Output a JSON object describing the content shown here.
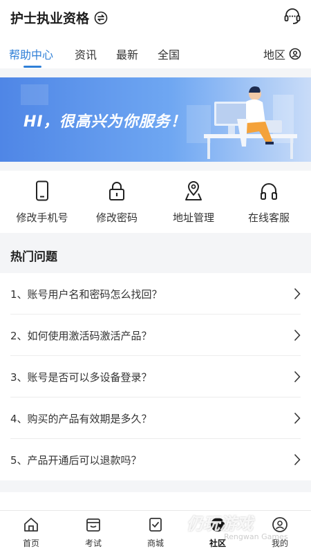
{
  "header": {
    "title": "护士执业资格"
  },
  "tabs": [
    "帮助中心",
    "资讯",
    "最新",
    "全国"
  ],
  "region_label": "地区",
  "banner": {
    "text": "HI，很高兴为你服务！"
  },
  "quick_actions": [
    {
      "label": "修改手机号",
      "icon": "phone-icon"
    },
    {
      "label": "修改密码",
      "icon": "lock-icon"
    },
    {
      "label": "地址管理",
      "icon": "location-icon"
    },
    {
      "label": "在线客服",
      "icon": "headphones-icon"
    }
  ],
  "hot": {
    "title": "热门问题",
    "items": [
      "1、账号用户名和密码怎么找回？",
      "2、如何使用激活码激活产品？",
      "3、账号是否可以多设备登录？",
      "4、购买的产品有效期是多久？",
      "5、产品开通后可以退款吗？"
    ]
  },
  "nav": [
    {
      "label": "首页",
      "icon": "home-icon"
    },
    {
      "label": "考试",
      "icon": "exam-icon"
    },
    {
      "label": "商城",
      "icon": "shop-icon"
    },
    {
      "label": "社区",
      "icon": "community-icon"
    },
    {
      "label": "我的",
      "icon": "profile-icon"
    }
  ],
  "watermark": {
    "main": "仍玩游戏",
    "sub": "Rengwan Games"
  },
  "colors": {
    "accent": "#2f7fd7",
    "banner": "#4f86e6"
  }
}
